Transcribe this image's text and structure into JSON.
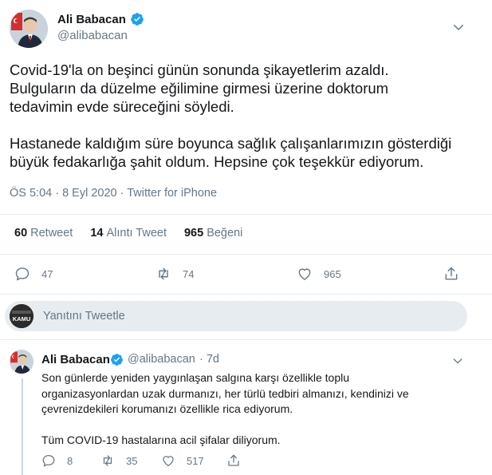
{
  "tweet": {
    "author_name": "Ali Babacan",
    "author_handle": "@alibabacan",
    "paragraphs": [
      [
        "Covid-19'la on beşinci günün sonunda şikayetlerim azaldı.",
        "Bulguların da düzelme eğilimine girmesi üzerine doktorum",
        "tedavimin evde süreceğini söyledi."
      ],
      [
        "Hastanede kaldığım süre boyunca sağlık çalışanlarımızın gösterdiği",
        "büyük fedakarlığa şahit oldum. Hepsine çok teşekkür ediyorum."
      ]
    ],
    "timestamp": "ÖS 5:04 · 8 Eyl 2020 · Twitter for iPhone",
    "stats": {
      "retweets_count": "60",
      "retweets_label": "Retweet",
      "quotes_count": "14",
      "quotes_label": "Alıntı Tweet",
      "likes_count": "965",
      "likes_label": "Beğeni"
    },
    "actions": {
      "reply_count": "47",
      "retweet_count": "74",
      "like_count": "965"
    }
  },
  "compose": {
    "placeholder": "Yanıtını Tweetle",
    "avatar_text": "KAMU"
  },
  "reply": {
    "author_name": "Ali Babacan",
    "author_handle": "@alibabacan",
    "time": "· 7d",
    "paragraphs": [
      [
        "Son günlerde yeniden yaygınlaşan salgına karşı özellikle toplu",
        "organizasyonlardan uzak durmanızı, her türlü tedbiri almanızı, kendinizi ve",
        "çevrenizdekileri korumanızı özellikle rica ediyorum."
      ],
      [
        "Tüm COVID-19 hastalarına acil şifalar diliyorum."
      ]
    ],
    "actions": {
      "reply_count": "8",
      "retweet_count": "35",
      "like_count": "517"
    }
  },
  "colors": {
    "verified": "#1da1f2",
    "text_primary": "#14171a",
    "text_secondary": "#657786",
    "divider": "#e6ecf0"
  }
}
